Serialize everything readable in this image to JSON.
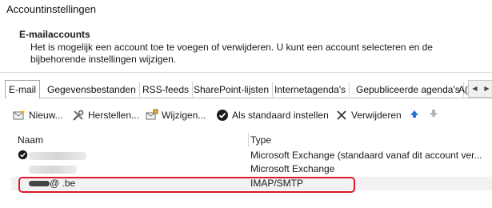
{
  "window": {
    "title": "Accountinstellingen"
  },
  "section": {
    "title": "E-mailaccounts",
    "description": "Het is mogelijk een account toe te voegen of verwijderen. U kunt een account selecteren en de bijbehorende instellingen wijzigen."
  },
  "tabs": [
    {
      "label": "E-mail",
      "active": true
    },
    {
      "label": "Gegevensbestanden"
    },
    {
      "label": "RSS-feeds"
    },
    {
      "label": "SharePoint-lijsten"
    },
    {
      "label": "Internetagenda's"
    },
    {
      "label": "Gepubliceerde agenda's"
    },
    {
      "label": "A("
    }
  ],
  "tab_scroll": {
    "left_icon": "triangle-left-icon",
    "right_icon": "triangle-right-icon"
  },
  "toolbar": {
    "new_label": "Nieuw...",
    "repair_label": "Herstellen...",
    "change_label": "Wijzigen...",
    "set_default_label": "Als standaard instellen",
    "remove_label": "Verwijderen",
    "move_up_icon": "arrow-up-icon",
    "move_down_icon": "arrow-down-icon"
  },
  "list": {
    "col_name": "Naam",
    "col_type": "Type",
    "rows": [
      {
        "name": "",
        "type": "Microsoft Exchange (standaard vanaf dit account ver...",
        "default": true
      },
      {
        "name": "",
        "type": "Microsoft Exchange"
      },
      {
        "name": "@ .be",
        "type": "IMAP/SMTP",
        "selected": true
      }
    ]
  },
  "colors": {
    "highlight_border": "#e0182a",
    "accent": "#2a6fd6"
  }
}
